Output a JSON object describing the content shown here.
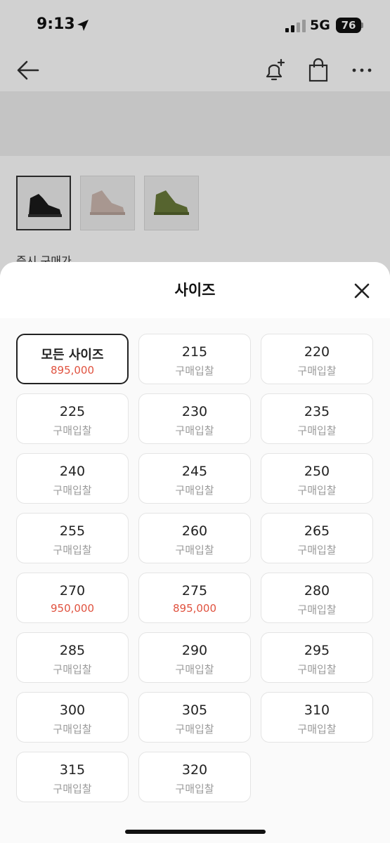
{
  "status": {
    "time": "9:13",
    "network": "5G",
    "battery": "76"
  },
  "background": {
    "partial_label": "즉시 구매가"
  },
  "sheet": {
    "title": "사이즈",
    "sizes": [
      {
        "size": "모든 사이즈",
        "price": "895,000",
        "highlight": true,
        "selected": true
      },
      {
        "size": "215",
        "price": "구매입찰",
        "highlight": false,
        "selected": false
      },
      {
        "size": "220",
        "price": "구매입찰",
        "highlight": false,
        "selected": false
      },
      {
        "size": "225",
        "price": "구매입찰",
        "highlight": false,
        "selected": false
      },
      {
        "size": "230",
        "price": "구매입찰",
        "highlight": false,
        "selected": false
      },
      {
        "size": "235",
        "price": "구매입찰",
        "highlight": false,
        "selected": false
      },
      {
        "size": "240",
        "price": "구매입찰",
        "highlight": false,
        "selected": false
      },
      {
        "size": "245",
        "price": "구매입찰",
        "highlight": false,
        "selected": false
      },
      {
        "size": "250",
        "price": "구매입찰",
        "highlight": false,
        "selected": false
      },
      {
        "size": "255",
        "price": "구매입찰",
        "highlight": false,
        "selected": false
      },
      {
        "size": "260",
        "price": "구매입찰",
        "highlight": false,
        "selected": false
      },
      {
        "size": "265",
        "price": "구매입찰",
        "highlight": false,
        "selected": false
      },
      {
        "size": "270",
        "price": "950,000",
        "highlight": true,
        "selected": false
      },
      {
        "size": "275",
        "price": "895,000",
        "highlight": true,
        "selected": false
      },
      {
        "size": "280",
        "price": "구매입찰",
        "highlight": false,
        "selected": false
      },
      {
        "size": "285",
        "price": "구매입찰",
        "highlight": false,
        "selected": false
      },
      {
        "size": "290",
        "price": "구매입찰",
        "highlight": false,
        "selected": false
      },
      {
        "size": "295",
        "price": "구매입찰",
        "highlight": false,
        "selected": false
      },
      {
        "size": "300",
        "price": "구매입찰",
        "highlight": false,
        "selected": false
      },
      {
        "size": "305",
        "price": "구매입찰",
        "highlight": false,
        "selected": false
      },
      {
        "size": "310",
        "price": "구매입찰",
        "highlight": false,
        "selected": false
      },
      {
        "size": "315",
        "price": "구매입찰",
        "highlight": false,
        "selected": false
      },
      {
        "size": "320",
        "price": "구매입찰",
        "highlight": false,
        "selected": false
      }
    ]
  },
  "colors": {
    "price_highlight": "#e0523f",
    "price_muted": "#9a9a9a"
  },
  "icons": [
    "location-arrow-icon",
    "signal-icon",
    "back-arrow-icon",
    "bell-plus-icon",
    "shopping-bag-icon",
    "more-icon",
    "close-icon"
  ]
}
